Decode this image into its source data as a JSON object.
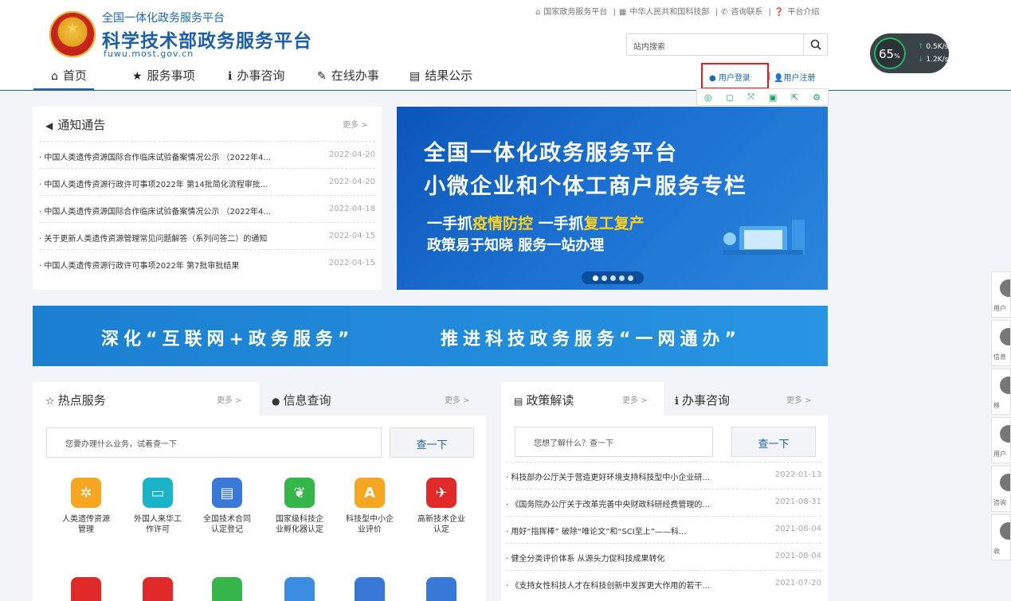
{
  "header": {
    "subtitle": "全国一体化政务服务平台",
    "title": "科学技术部政务服务平台",
    "url": "fuwu.most.gov.cn",
    "toplinks": [
      "国家政务服务平台",
      "中华人民共和国科技部",
      "咨询联系",
      "平台介绍"
    ],
    "search_placeholder": "站内搜索",
    "login": "用户登录",
    "register": "用户注册"
  },
  "nav": [
    "首页",
    "服务事项",
    "办事咨询",
    "在线办事",
    "结果公示"
  ],
  "speed": {
    "percent": "65",
    "unit": "%",
    "up": "0.5",
    "down": "1.2",
    "rate_unit": "K/s"
  },
  "notice": {
    "title": "通知通告",
    "more": "更多 >",
    "items": [
      {
        "text": "中国人类遗传资源国际合作临床试验备案情况公示 （2022年4...",
        "date": "2022-04-20"
      },
      {
        "text": "中国人类遗传资源行政许可事项2022年 第14批简化流程审批...",
        "date": "2022-04-20"
      },
      {
        "text": "中国人类遗传资源国际合作临床试验备案情况公示 （2022年4...",
        "date": "2022-04-18"
      },
      {
        "text": "关于更新人类遗传资源管理常见问题解答（系列问答二）的通知",
        "date": "2022-04-15"
      },
      {
        "text": "中国人类遗传资源行政许可事项2022年 第7批审批结果",
        "date": "2022-04-15"
      }
    ]
  },
  "banner": {
    "line1": "全国一体化政务服务平台",
    "line2": "小微企业和个体工商户服务专栏",
    "line3a": "一手抓",
    "line3b": "疫情防控",
    "line3c": " 一手抓",
    "line3d": "复工复产",
    "line4": "政策易于知晓 服务一站办理"
  },
  "slogan": {
    "left": "深化“互联网+政务服务”",
    "right": "推进科技政务服务“一网通办”"
  },
  "hot": {
    "tab1": "热点服务",
    "tab1_more": "更多 >",
    "tab2": "信息查询",
    "tab2_more": "更多 >",
    "placeholder": "您要办理什么业务，试着查一下",
    "button": "查一下",
    "services": [
      {
        "label1": "人类遗传资源",
        "label2": "管理",
        "color": "#f5a623"
      },
      {
        "label1": "外国人来华工",
        "label2": "作许可",
        "color": "#1ab3c8"
      },
      {
        "label1": "全国技术合同",
        "label2": "认定登记",
        "color": "#3a78d8"
      },
      {
        "label1": "国家级科技企",
        "label2": "业孵化器认定",
        "color": "#36b54a"
      },
      {
        "label1": "科技型中小企",
        "label2": "业评价",
        "color": "#f5a623"
      },
      {
        "label1": "高新技术企业",
        "label2": "认定",
        "color": "#e02a2a"
      }
    ],
    "row2_colors": [
      "#e02a2a",
      "#e02a2a",
      "#36b54a",
      "#3a8de0",
      "#3a78d8",
      "#3a78d8"
    ]
  },
  "policy": {
    "tab1": "政策解读",
    "tab1_more": "更多 >",
    "tab2": "办事咨询",
    "tab2_more": "更多 >",
    "placeholder": "您想了解什么？查一下",
    "button": "查一下",
    "items": [
      {
        "text": "科技部办公厅关于营造更好环境支持科技型中小企业研...",
        "date": "2022-01-13"
      },
      {
        "text": "《国务院办公厅关于改革完善中央财政科研经费管理的...",
        "date": "2021-08-31"
      },
      {
        "text": "用好“指挥棒” 破除“唯论文”和“SCI至上”——科...",
        "date": "2021-08-04"
      },
      {
        "text": "健全分类评价体系 从源头力促科技成果转化",
        "date": "2021-08-04"
      },
      {
        "text": "《支持女性科技人才在科技创新中发挥更大作用的若干...",
        "date": "2021-07-20"
      }
    ]
  },
  "sidebar": [
    "用户",
    "信息",
    "移",
    "用户",
    "咨询",
    "收"
  ]
}
